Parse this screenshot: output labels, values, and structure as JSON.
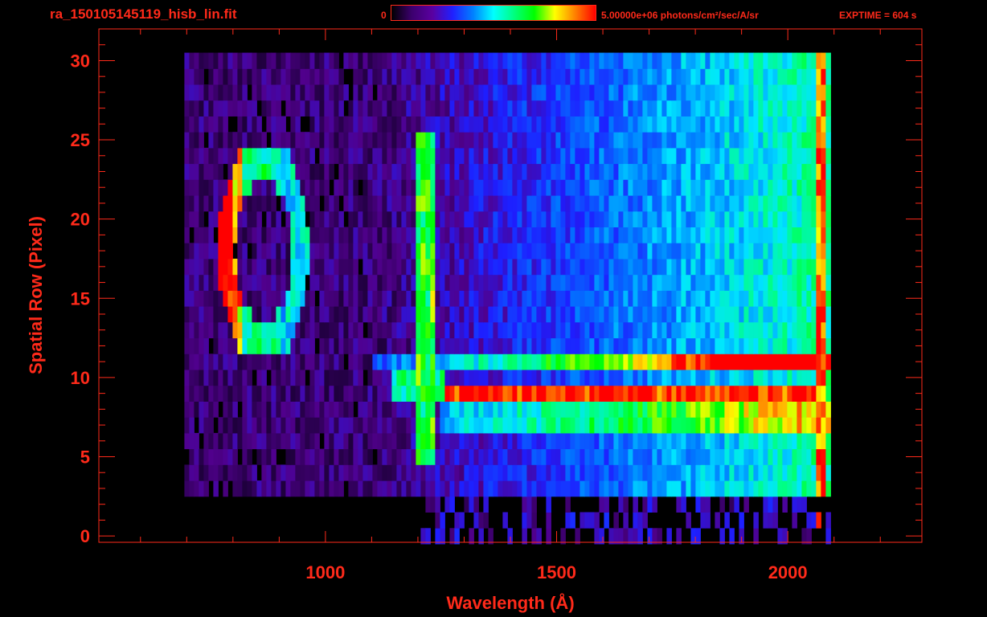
{
  "header": {
    "filename": "ra_150105145119_hisb_lin.fit",
    "colorbar_min": "0",
    "colorbar_max": "5.00000e+06 photons/cm²/sec/A/sr",
    "exptime": "EXPTIME = 604 s"
  },
  "colors": {
    "axes": "#ff2a1a",
    "background": "#000000",
    "colormap": [
      "#000000",
      "#3c006e",
      "#5a00a0",
      "#2020ff",
      "#0080ff",
      "#00ffff",
      "#00ff80",
      "#00ff00",
      "#ffff00",
      "#ff8000",
      "#ff0000"
    ]
  },
  "chart_data": {
    "type": "heatmap",
    "title": "ra_150105145119_hisb_lin.fit",
    "xlabel": "Wavelength (Å)",
    "ylabel": "Spatial Row (Pixel)",
    "xlim": [
      510,
      2290
    ],
    "ylim": [
      -0.4,
      32.0
    ],
    "x_ticks": [
      1000,
      1500,
      2000
    ],
    "y_ticks": [
      0,
      5,
      10,
      15,
      20,
      25,
      30
    ],
    "colorbar": {
      "min": 0,
      "max": 5000000,
      "units": "photons/cm²/sec/A/sr"
    },
    "data_extent": {
      "x": [
        695,
        2085
      ],
      "y": [
        0,
        30
      ]
    },
    "features": [
      {
        "x_range": [
          1195,
          1230
        ],
        "y_range": [
          5,
          25
        ],
        "level": "green"
      },
      {
        "x_range": [
          1250,
          2070
        ],
        "y_range": [
          8,
          10
        ],
        "level": "red"
      },
      {
        "x_range": [
          2060,
          2075
        ],
        "y_range": [
          0,
          30
        ],
        "level": "orange"
      },
      {
        "x_range": [
          760,
          960
        ],
        "y_range": [
          12,
          24
        ],
        "level": "orange-red"
      }
    ]
  }
}
